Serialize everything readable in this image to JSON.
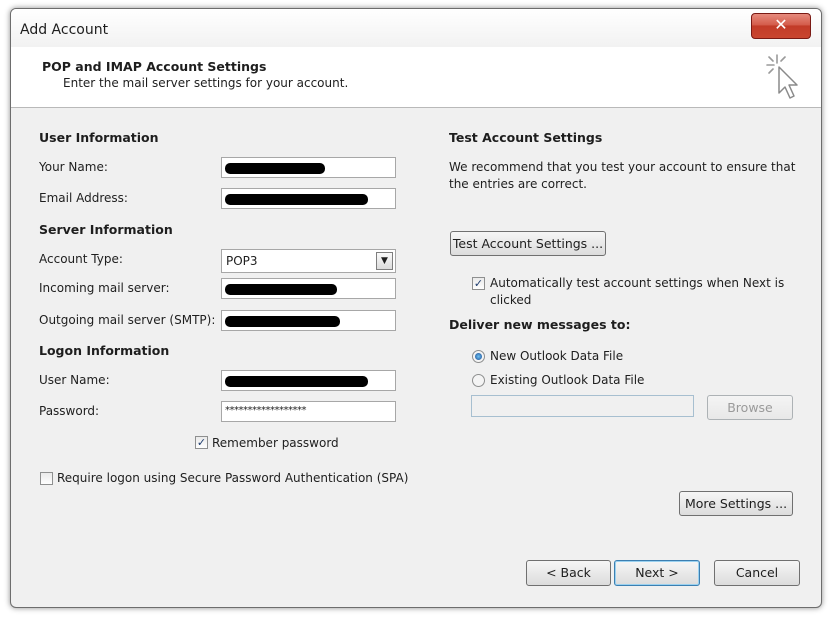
{
  "window": {
    "title": "Add Account",
    "close_glyph": "✕"
  },
  "header": {
    "title": "POP and IMAP Account Settings",
    "subtitle": "Enter the mail server settings for your account.",
    "icon": "wand-cursor-icon"
  },
  "user_info": {
    "heading": "User Information",
    "your_name_label": "Your Name:",
    "email_label": "Email Address:"
  },
  "server_info": {
    "heading": "Server Information",
    "account_type_label": "Account Type:",
    "account_type_value": "POP3",
    "incoming_label": "Incoming mail server:",
    "outgoing_label": "Outgoing mail server (SMTP):"
  },
  "logon_info": {
    "heading": "Logon Information",
    "username_label": "User Name:",
    "password_label": "Password:",
    "password_value": "******************",
    "remember_label": "Remember password",
    "remember_checked": true,
    "spa_label": "Require logon using Secure Password Authentication (SPA)",
    "spa_checked": false
  },
  "test_settings": {
    "heading": "Test Account Settings",
    "description_line1": "We recommend that you test your account to ensure that",
    "description_line2": "the entries are correct.",
    "test_button": "Test Account Settings ...",
    "auto_test_line1": "Automatically test account settings when Next is",
    "auto_test_line2": "clicked",
    "auto_test_checked": true
  },
  "deliver": {
    "heading": "Deliver new messages to:",
    "option_new": "New Outlook Data File",
    "option_existing": "Existing Outlook Data File",
    "selected": "new",
    "browse_button": "Browse"
  },
  "more_settings_button": "More Settings ...",
  "footer": {
    "back": "< Back",
    "next": "Next >",
    "cancel": "Cancel"
  },
  "glyphs": {
    "check": "✓",
    "dropdown": "▼"
  }
}
